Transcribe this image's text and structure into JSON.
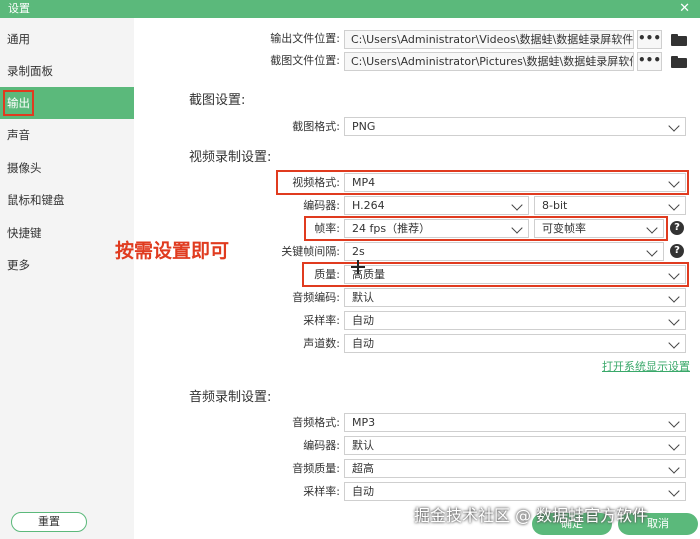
{
  "window": {
    "title": "设置",
    "close": "✕"
  },
  "sidebar": {
    "items": [
      {
        "label": "通用"
      },
      {
        "label": "录制面板"
      },
      {
        "label": "输出"
      },
      {
        "label": "声音"
      },
      {
        "label": "摄像头"
      },
      {
        "label": "鼠标和键盘"
      },
      {
        "label": "快捷键"
      },
      {
        "label": "更多"
      }
    ],
    "active_index": 2,
    "reset_label": "重置"
  },
  "output": {
    "file_location_label": "输出文件位置:",
    "file_location_value": "C:\\Users\\Administrator\\Videos\\数据蛙\\数据蛙录屏软件",
    "screenshot_location_label": "截图文件位置:",
    "screenshot_location_value": "C:\\Users\\Administrator\\Pictures\\数据蛙\\数据蛙录屏软件",
    "more_icon": "•••"
  },
  "screenshot_settings": {
    "title": "截图设置:",
    "format_label": "截图格式:",
    "format_value": "PNG"
  },
  "video_settings": {
    "title": "视频录制设置:",
    "format_label": "视频格式:",
    "format_value": "MP4",
    "encoder_label": "编码器:",
    "encoder_value": "H.264",
    "bitdepth_value": "8-bit",
    "framerate_label": "帧率:",
    "framerate_value": "24 fps（推荐）",
    "framerate_mode_value": "可变帧率",
    "keyframe_label": "关键帧间隔:",
    "keyframe_value": "2s",
    "quality_label": "质量:",
    "quality_value": "高质量",
    "audio_codec_label": "音频编码:",
    "audio_codec_value": "默认",
    "sample_rate_label": "采样率:",
    "sample_rate_value": "自动",
    "channels_label": "声道数:",
    "channels_value": "自动",
    "open_system_display_link": "打开系统显示设置",
    "help_icon": "?"
  },
  "audio_settings": {
    "title": "音频录制设置:",
    "format_label": "音频格式:",
    "format_value": "MP3",
    "encoder_label": "编码器:",
    "encoder_value": "默认",
    "quality_label": "音频质量:",
    "quality_value": "超高",
    "sample_rate_label": "采样率:",
    "sample_rate_value": "自动"
  },
  "annotation": {
    "text": "按需设置即可"
  },
  "footer": {
    "ok_label": "确定",
    "cancel_label": "取消",
    "watermark": "掘金技术社区 @ 数据蛙官方软件"
  },
  "colors": {
    "accent": "#5bb97b",
    "highlight": "#e03b1f",
    "link": "#3aa86a"
  }
}
